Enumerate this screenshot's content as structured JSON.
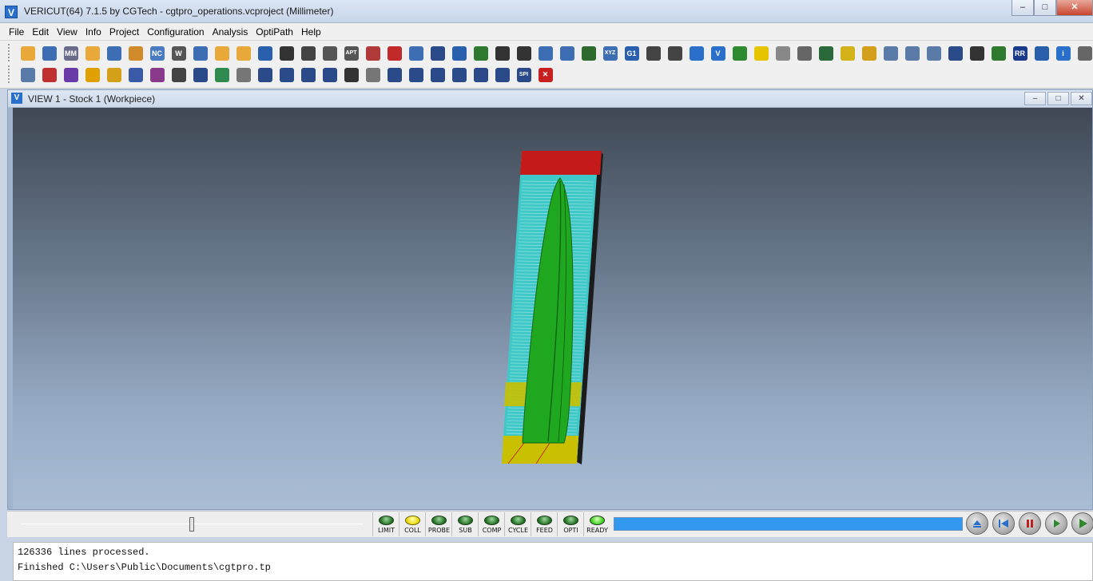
{
  "window": {
    "title": "VERICUT(64)  7.1.5 by CGTech - cgtpro_operations.vcproject (Millimeter)",
    "app_icon": "V",
    "controls": [
      "minimize",
      "maximize",
      "close"
    ]
  },
  "menu": [
    "File",
    "Edit",
    "View",
    "Info",
    "Project",
    "Configuration",
    "Analysis",
    "OptiPath",
    "Help"
  ],
  "toolbar": {
    "row1": [
      {
        "icon": "open-folder-icon",
        "color": "#e8a83a"
      },
      {
        "icon": "save-icon",
        "color": "#3d6db3"
      },
      {
        "icon": "machine-icon",
        "color": "#6a6a8a",
        "text": "MM"
      },
      {
        "icon": "open-project-icon",
        "color": "#e8a83a"
      },
      {
        "icon": "save-project-icon",
        "color": "#3d6db3"
      },
      {
        "icon": "import-icon",
        "color": "#d08a2a"
      },
      {
        "icon": "nc-file-icon",
        "color": "#4a7ac0",
        "text": "NC"
      },
      {
        "icon": "wave-icon",
        "color": "#555555",
        "text": "W"
      },
      {
        "icon": "save-as-icon",
        "color": "#3d6db3"
      },
      {
        "icon": "folder-a-icon",
        "color": "#e8a83a"
      },
      {
        "icon": "folder-b-icon",
        "color": "#e8a83a"
      },
      {
        "icon": "tool-manager-icon",
        "color": "#2a5fae"
      },
      {
        "icon": "arrow-in-icon",
        "color": "#333333"
      },
      {
        "icon": "setup-icon",
        "color": "#444444"
      },
      {
        "icon": "apt-tree-icon",
        "color": "#555555"
      },
      {
        "icon": "apt-icon",
        "color": "#555555",
        "text": "APT"
      },
      {
        "icon": "model-list-icon",
        "color": "#b03a3a"
      },
      {
        "icon": "stock-red-icon",
        "color": "#c22a2a"
      },
      {
        "icon": "disk-icon",
        "color": "#3d6db3"
      },
      {
        "icon": "cycle-icon",
        "color": "#2a4a8a"
      },
      {
        "icon": "check-shield-icon",
        "color": "#2a5fae"
      },
      {
        "icon": "grid-table-icon",
        "color": "#2e7a2e"
      },
      {
        "icon": "axis-icon",
        "color": "#333333"
      },
      {
        "icon": "target-icon",
        "color": "#333333"
      },
      {
        "icon": "report-icon",
        "color": "#3d6db3"
      },
      {
        "icon": "report-b-icon",
        "color": "#3d6db3"
      },
      {
        "icon": "turret-icon",
        "color": "#2e6a2e"
      },
      {
        "icon": "xyz-icon",
        "color": "#3d6db3",
        "text": "XYZ"
      },
      {
        "icon": "g1-icon",
        "color": "#2a5fae",
        "text": "G1"
      },
      {
        "icon": "sequence-icon",
        "color": "#444444"
      },
      {
        "icon": "list-icon",
        "color": "#444444"
      },
      {
        "icon": "probe-icon",
        "color": "#2a6fc9"
      },
      {
        "icon": "vericut-icon",
        "color": "#2a6fc9",
        "text": "V"
      },
      {
        "icon": "move-green-icon",
        "color": "#2e8a2e"
      },
      {
        "icon": "diamond-yellow-icon",
        "color": "#e6c400"
      },
      {
        "icon": "diamond-b-icon",
        "color": "#888888"
      },
      {
        "icon": "diamond-c-icon",
        "color": "#666666"
      },
      {
        "icon": "book-icon",
        "color": "#2a6a3a"
      },
      {
        "icon": "cube-yellow-icon",
        "color": "#d4b21a"
      },
      {
        "icon": "palette-icon",
        "color": "#d4a01a"
      },
      {
        "icon": "zoom-out-icon",
        "color": "#5a7aa8"
      },
      {
        "icon": "zoom-in-icon",
        "color": "#5a7aa8"
      },
      {
        "icon": "zoom-box-icon",
        "color": "#5a7aa8"
      },
      {
        "icon": "fit-view-icon",
        "color": "#2a4a8a"
      },
      {
        "icon": "eye-icon",
        "color": "#333333"
      },
      {
        "icon": "eye-green-icon",
        "color": "#2e7a2e"
      },
      {
        "icon": "rr-icon",
        "color": "#1a3a8a",
        "text": "RR"
      },
      {
        "icon": "help-book-icon",
        "color": "#2a5fae"
      },
      {
        "icon": "info-icon",
        "color": "#2a6fc9",
        "text": "i"
      },
      {
        "icon": "measure-icon",
        "color": "#666666"
      }
    ],
    "row2": [
      {
        "icon": "view-props-icon",
        "color": "#5a7aa8"
      },
      {
        "icon": "delete-model-icon",
        "color": "#c03030"
      },
      {
        "icon": "color-cube-icon",
        "color": "#6a3aa8"
      },
      {
        "icon": "lightning-icon",
        "color": "#e0a000"
      },
      {
        "icon": "cube-outline-icon",
        "color": "#d4a01a"
      },
      {
        "icon": "layers-icon",
        "color": "#3a5aa8"
      },
      {
        "icon": "cut-stock-icon",
        "color": "#8a3a8a"
      },
      {
        "icon": "table-icon",
        "color": "#444444"
      },
      {
        "icon": "fixture-icon",
        "color": "#2a4a8a"
      },
      {
        "icon": "section-icon",
        "color": "#2e8a4e"
      },
      {
        "icon": "print-icon",
        "color": "#777777"
      },
      {
        "icon": "magnet-x-icon",
        "color": "#2a4a8a"
      },
      {
        "icon": "magnet-check-icon",
        "color": "#2a4a8a"
      },
      {
        "icon": "magnet-rotate-icon",
        "color": "#2a4a8a"
      },
      {
        "icon": "magnet-b-icon",
        "color": "#2a4a8a"
      },
      {
        "icon": "move-arrows-icon",
        "color": "#333333"
      },
      {
        "icon": "rotate-icon",
        "color": "#777777"
      },
      {
        "icon": "single-view-icon",
        "color": "#2a4a8a"
      },
      {
        "icon": "two-vertical-icon",
        "color": "#2a4a8a"
      },
      {
        "icon": "two-horizontal-icon",
        "color": "#2a4a8a"
      },
      {
        "icon": "three-left-icon",
        "color": "#2a4a8a"
      },
      {
        "icon": "three-top-icon",
        "color": "#2a4a8a"
      },
      {
        "icon": "four-view-icon",
        "color": "#2a4a8a"
      },
      {
        "icon": "spi-icon",
        "color": "#2a4a8a",
        "text": "SPI"
      },
      {
        "icon": "close-x-icon",
        "color": "#c82020",
        "text": "✕"
      }
    ]
  },
  "view": {
    "title": "VIEW 1 - Stock 1 (Workpiece)",
    "icon": "V"
  },
  "status": {
    "slider_position": 0.49,
    "leds": [
      {
        "label": "LIMIT",
        "state": "green"
      },
      {
        "label": "COLL",
        "state": "yellow"
      },
      {
        "label": "PROBE",
        "state": "green"
      },
      {
        "label": "SUB",
        "state": "green"
      },
      {
        "label": "COMP",
        "state": "green"
      },
      {
        "label": "CYCLE",
        "state": "green"
      },
      {
        "label": "FEED",
        "state": "green"
      },
      {
        "label": "OPTI",
        "state": "green"
      },
      {
        "label": "READY",
        "state": "bright"
      }
    ],
    "progress": 1.0,
    "progress_color": "#3399ee",
    "playback": [
      "rewind-icon",
      "reset-icon",
      "pause-icon",
      "step-icon",
      "play-icon"
    ]
  },
  "log": {
    "lines": [
      "126336 lines processed.",
      "Finished C:\\Users\\Public\\Documents\\cgtpro.tp"
    ]
  },
  "colors": {
    "stock_red": "#c41a1a",
    "stock_yellow": "#c8c000",
    "toolpath_cyan": "#3fc8c8",
    "part_green": "#1fa81f"
  }
}
